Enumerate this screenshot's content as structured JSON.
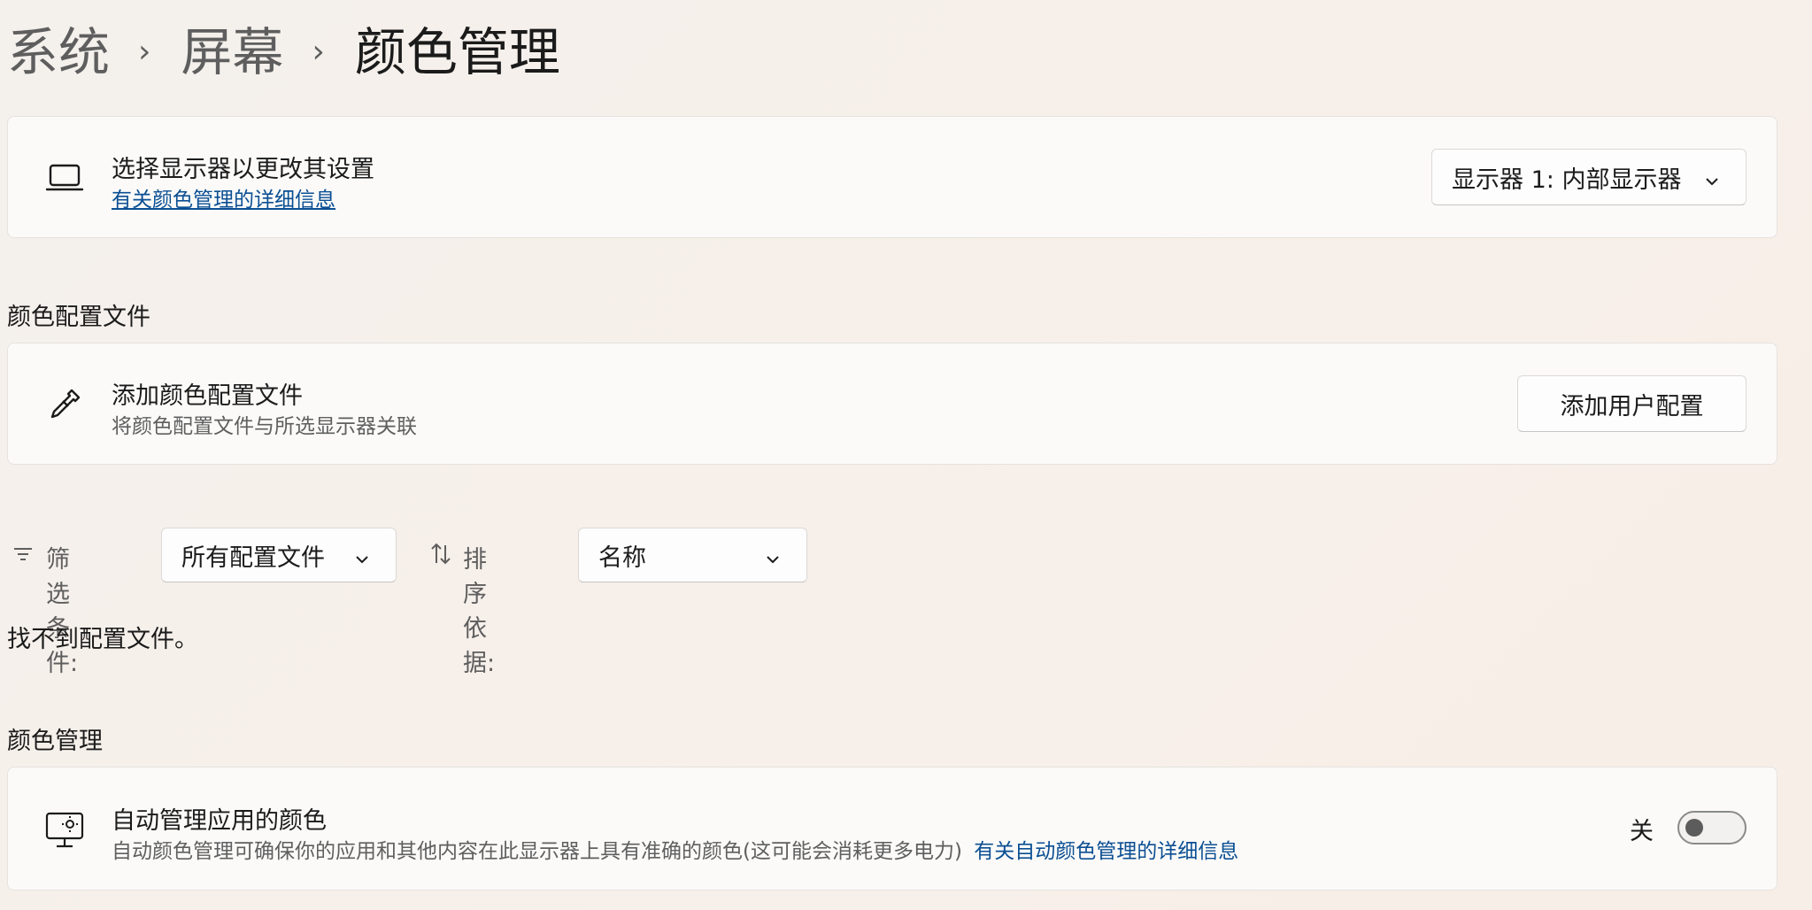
{
  "breadcrumb": {
    "items": [
      "系统",
      "屏幕"
    ],
    "current": "颜色管理",
    "separator": "›"
  },
  "display_card": {
    "title": "选择显示器以更改其设置",
    "link": "有关颜色管理的详细信息",
    "dropdown_value": "显示器 1: 内部显示器",
    "icon": "laptop-icon"
  },
  "profiles_section": {
    "heading": "颜色配置文件",
    "add_card": {
      "title": "添加颜色配置文件",
      "subtitle": "将颜色配置文件与所选显示器关联",
      "button": "添加用户配置",
      "icon": "eyedropper-icon"
    },
    "filter": {
      "label": "筛选条件:",
      "value": "所有配置文件",
      "icon": "filter-icon"
    },
    "sort": {
      "label": "排序依据:",
      "value": "名称",
      "icon": "sort-icon"
    },
    "empty_message": "找不到配置文件。"
  },
  "color_mgmt_section": {
    "heading": "颜色管理",
    "auto_card": {
      "title": "自动管理应用的颜色",
      "subtitle": "自动颜色管理可确保你的应用和其他内容在此显示器上具有准确的颜色(这可能会消耗更多电力)",
      "link": "有关自动颜色管理的详细信息",
      "toggle_state": "关",
      "toggle_on": false,
      "icon": "monitor-brightness-icon"
    }
  },
  "colors": {
    "accent_link": "#0b4f93",
    "card_bg": "#fbfaf9"
  }
}
